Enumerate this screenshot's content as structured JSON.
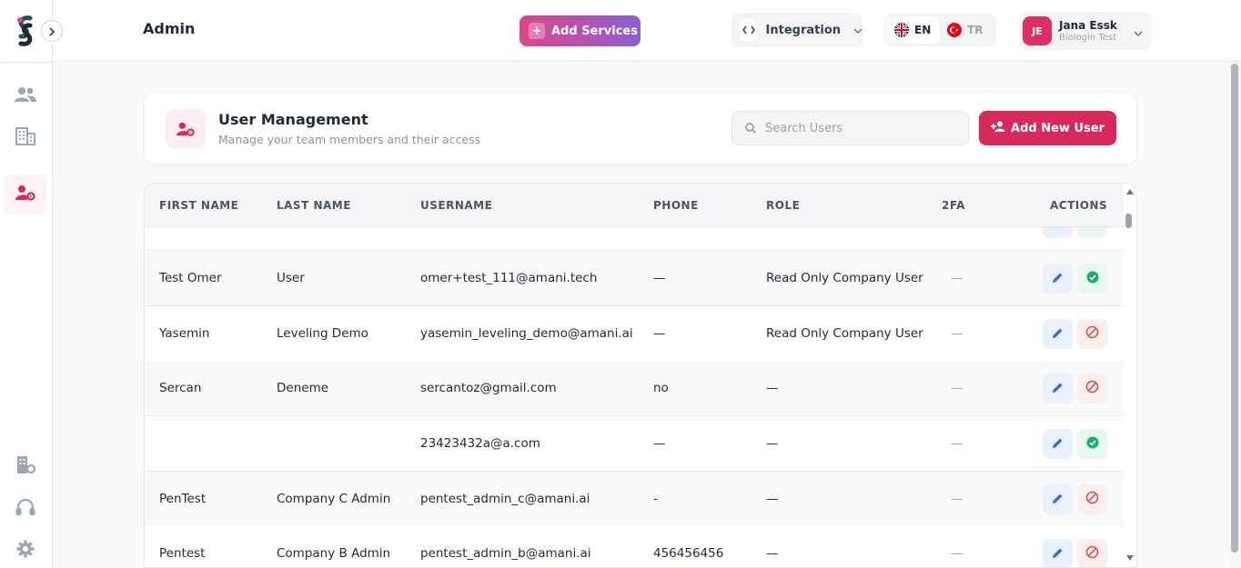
{
  "header": {
    "title": "Admin",
    "add_services_label": "Add Services",
    "integration_label": "Integration",
    "languages": [
      {
        "code": "EN",
        "active": true
      },
      {
        "code": "TR",
        "active": false
      }
    ],
    "user": {
      "initials": "JE",
      "name": "Jana Essk",
      "org": "Biologin Test"
    }
  },
  "sidebar": {
    "items": [
      {
        "name": "users",
        "icon": "users-icon",
        "active": false
      },
      {
        "name": "companies",
        "icon": "building-icon",
        "active": false
      },
      {
        "name": "user-management",
        "icon": "user-gear-icon",
        "active": true
      }
    ],
    "bottom_items": [
      {
        "name": "company-settings",
        "icon": "building-gear-icon"
      },
      {
        "name": "support",
        "icon": "headset-icon"
      },
      {
        "name": "settings",
        "icon": "gear-icon"
      }
    ]
  },
  "section": {
    "title": "User Management",
    "subtitle": "Manage your team members and their access",
    "search_placeholder": "Search Users",
    "add_user_label": "Add New User"
  },
  "table": {
    "columns": [
      "FIRST NAME",
      "LAST NAME",
      "USERNAME",
      "PHONE",
      "ROLE",
      "2FA",
      "ACTIONS"
    ],
    "rows": [
      {
        "first": "Test Omer",
        "last": "User",
        "username": "omer+test_111@amani.tech",
        "phone": "—",
        "role": "Read Only Company User",
        "tfa": "—",
        "status": "active"
      },
      {
        "first": "Yasemin",
        "last": "Leveling Demo",
        "username": "yasemin_leveling_demo@amani.ai",
        "phone": "—",
        "role": "Read Only Company User",
        "tfa": "—",
        "status": "blocked"
      },
      {
        "first": "Sercan",
        "last": "Deneme",
        "username": "sercantoz@gmail.com",
        "phone": "no",
        "role": "—",
        "tfa": "—",
        "status": "blocked"
      },
      {
        "first": "",
        "last": "",
        "username": "23423432a@a.com",
        "phone": "—",
        "role": "—",
        "tfa": "—",
        "status": "active"
      },
      {
        "first": "PenTest",
        "last": "Company C Admin",
        "username": "pentest_admin_c@amani.ai",
        "phone": "-",
        "role": "—",
        "tfa": "—",
        "status": "blocked"
      },
      {
        "first": "Pentest",
        "last": "Company B Admin",
        "username": "pentest_admin_b@amani.ai",
        "phone": "456456456",
        "role": "—",
        "tfa": "—",
        "status": "blocked"
      }
    ]
  },
  "colors": {
    "brand_pink": "#d8295a",
    "gradient_start": "#e0458a",
    "gradient_end": "#8d5fd3",
    "edit_blue": "#2f6fdc",
    "active_green": "#16b364",
    "block_red": "#e04a4a"
  }
}
